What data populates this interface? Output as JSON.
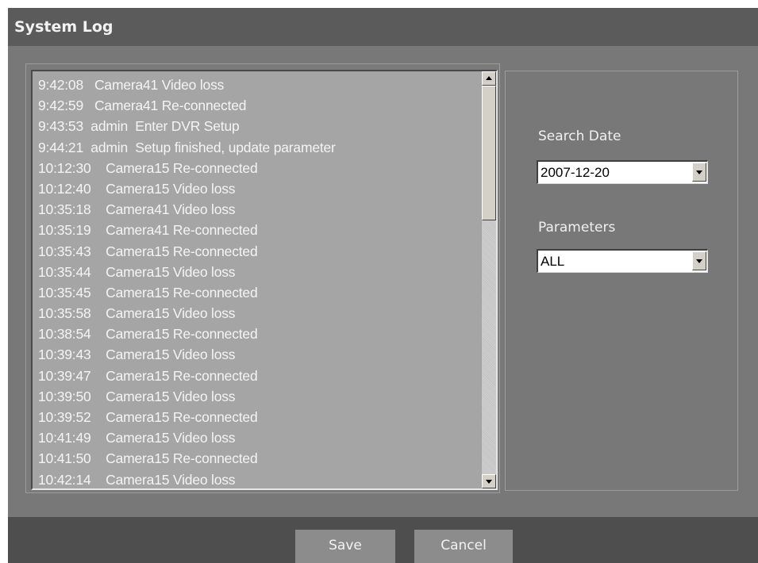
{
  "window": {
    "title": "System Log"
  },
  "log": {
    "entries": [
      "9:42:08   Camera41 Video loss",
      "9:42:59   Camera41 Re-connected",
      "9:43:53  admin  Enter DVR Setup",
      "9:44:21  admin  Setup finished, update parameter",
      "10:12:30    Camera15 Re-connected",
      "10:12:40    Camera15 Video loss",
      "10:35:18    Camera41 Video loss",
      "10:35:19    Camera41 Re-connected",
      "10:35:43    Camera15 Re-connected",
      "10:35:44    Camera15 Video loss",
      "10:35:45    Camera15 Re-connected",
      "10:35:58    Camera15 Video loss",
      "10:38:54    Camera15 Re-connected",
      "10:39:43    Camera15 Video loss",
      "10:39:47    Camera15 Re-connected",
      "10:39:50    Camera15 Video loss",
      "10:39:52    Camera15 Re-connected",
      "10:41:49    Camera15 Video loss",
      "10:41:50    Camera15 Re-connected",
      "10:42:14    Camera15 Video loss"
    ]
  },
  "filters": {
    "search_date_label": "Search Date",
    "search_date_value": "2007-12-20",
    "parameters_label": "Parameters",
    "parameters_value": "ALL"
  },
  "buttons": {
    "save": "Save",
    "cancel": "Cancel"
  },
  "colors": {
    "title_bar": "#5b5b5b",
    "panel": "#787878",
    "log_background": "#a5a5a5",
    "footer": "#4e4e4e",
    "button": "#8c8c8c",
    "text": "#f4f4f4"
  }
}
